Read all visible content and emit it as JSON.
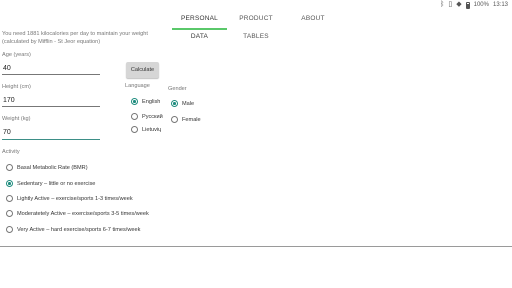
{
  "status": {
    "battery": "100%",
    "time": "13:13",
    "icons": [
      "bluetooth-icon",
      "vibrate-icon",
      "wifi-icon",
      "battery-icon"
    ]
  },
  "tabs": [
    {
      "label": "PERSONAL DATA",
      "active": true
    },
    {
      "label": "PRODUCT TABLES",
      "active": false
    },
    {
      "label": "ABOUT",
      "active": false
    }
  ],
  "info_line1": "You need 1881 kilocalories per day to maintain your weight",
  "info_line2": "(calculated by Mifflin - St Jeor equation)",
  "age": {
    "label": "Age (years)",
    "value": "40"
  },
  "height": {
    "label": "Height (cm)",
    "value": "170"
  },
  "weight": {
    "label": "Weight (kg)",
    "value": "70"
  },
  "calculate_label": "Calculate",
  "language": {
    "title": "Language",
    "options": [
      {
        "label": "English",
        "checked": true
      },
      {
        "label": "Русский",
        "checked": false
      },
      {
        "label": "Lietuvių",
        "checked": false
      }
    ]
  },
  "gender": {
    "title": "Gender",
    "options": [
      {
        "label": "Male",
        "checked": true
      },
      {
        "label": "Female",
        "checked": false
      }
    ]
  },
  "activity": {
    "title": "Activity",
    "options": [
      {
        "label": "Basal Metabolic Rate (BMR)",
        "checked": false
      },
      {
        "label": "Sedentary – little or no exercise",
        "checked": true
      },
      {
        "label": "Lightly Active – exercise/sports 1-3 times/week",
        "checked": false
      },
      {
        "label": "Moderatetely Active – exercise/sports 3-5 times/week",
        "checked": false
      },
      {
        "label": "Very Active – hard exercise/sports 6-7 times/week",
        "checked": false
      }
    ]
  },
  "colors": {
    "accent": "#1e8c7e",
    "tab_indicator": "#5ac86a",
    "button_bg": "#d6d6d6"
  }
}
